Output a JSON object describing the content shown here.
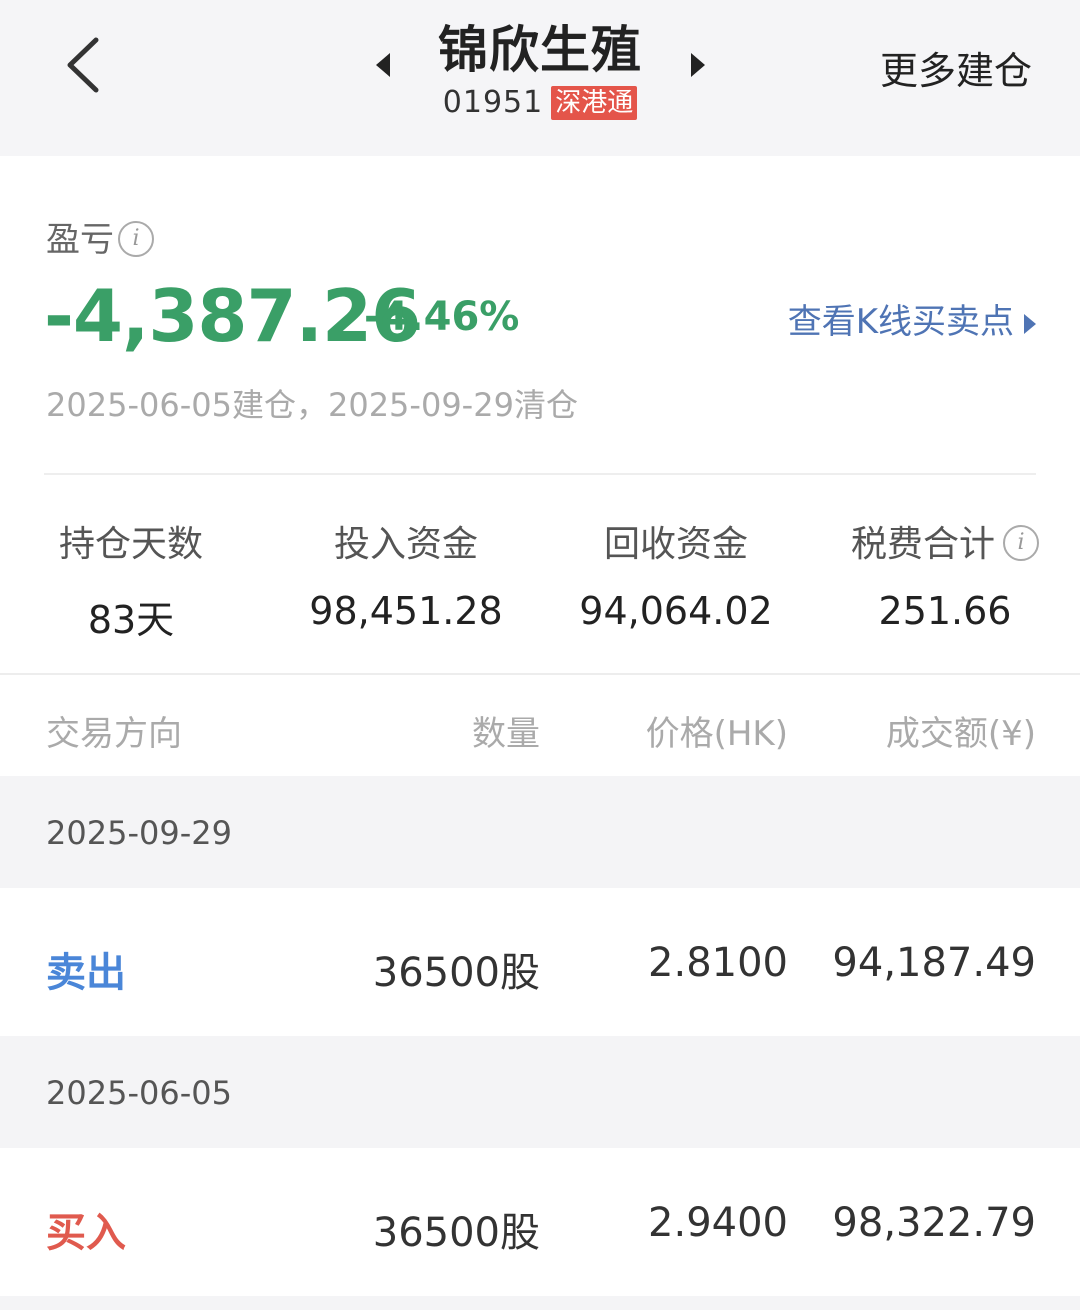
{
  "header": {
    "stock_name": "锦欣生殖",
    "stock_code": "01951",
    "market_badge": "深港通",
    "more_action": "更多建仓"
  },
  "pnl": {
    "label": "盈亏",
    "amount": "-4,387.26",
    "percent": "-4.46%",
    "kline_link": "查看K线买卖点",
    "dates": "2025-06-05建仓，2025-09-29清仓",
    "color": "#3a9f67"
  },
  "stats": [
    {
      "label": "持仓天数",
      "value": "83天"
    },
    {
      "label": "投入资金",
      "value": "98,451.28"
    },
    {
      "label": "回收资金",
      "value": "94,064.02"
    },
    {
      "label": "税费合计",
      "value": "251.66"
    }
  ],
  "table": {
    "headers": [
      "交易方向",
      "数量",
      "价格(HK)",
      "成交额(¥)"
    ],
    "groups": [
      {
        "date": "2025-09-29",
        "direction": "卖出",
        "quantity": "36500股",
        "price": "2.8100",
        "amount": "94,187.49"
      },
      {
        "date": "2025-06-05",
        "direction": "买入",
        "quantity": "36500股",
        "price": "2.9400",
        "amount": "98,322.79"
      }
    ]
  },
  "icons": {
    "back": "chevron-left-icon",
    "prev": "triangle-left-icon",
    "next": "triangle-right-icon",
    "info": "info-icon"
  },
  "colors": {
    "sell": "#4a86d8",
    "buy": "#e05a4e",
    "badge": "#e4554a",
    "link": "#4f74b4"
  }
}
